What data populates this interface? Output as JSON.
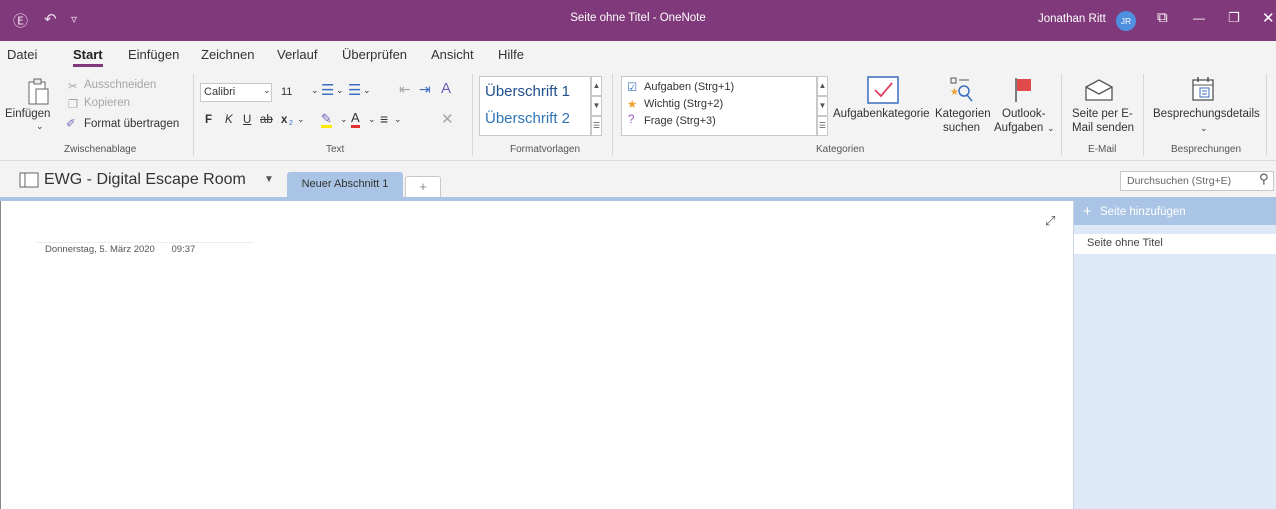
{
  "titlebar": {
    "title": "Seite ohne Titel - OneNote",
    "user": "Jonathan Ritt",
    "avatar": "JR",
    "back_icon": "Ⓔ",
    "undo_icon": "↶",
    "dropdown_icon": "▿",
    "ribbon_display_icon": "⧉",
    "minimize_icon": "—",
    "restore_icon": "❐",
    "close_icon": "✕",
    "color": "#80397b"
  },
  "menu": [
    "Datei",
    "Start",
    "Einfügen",
    "Zeichnen",
    "Verlauf",
    "Überprüfen",
    "Ansicht",
    "Hilfe"
  ],
  "menu_active": "Start",
  "ribbon": {
    "clipboard": {
      "paste": "Einfügen",
      "cut": "Ausschneiden",
      "copy": "Kopieren",
      "format_painter": "Format übertragen",
      "label": "Zwischenablage"
    },
    "text": {
      "font": "Calibri",
      "size": "11",
      "bold": "F",
      "italic": "K",
      "underline": "U",
      "strike": "ab",
      "subscript": "x",
      "label": "Text"
    },
    "styles": {
      "heading1": "Überschrift 1",
      "heading2": "Überschrift 2",
      "label": "Formatvorlagen"
    },
    "tags": {
      "items": [
        "Aufgaben (Strg+1)",
        "Wichtig (Strg+2)",
        "Frage (Strg+3)"
      ],
      "task_category": "Aufgabenkategorie",
      "search_tags_1": "Kategorien",
      "search_tags_2": "suchen",
      "outlook_1": "Outlook-",
      "outlook_2": "Aufgaben",
      "label": "Kategorien"
    },
    "email": {
      "line1": "Seite per E-",
      "line2": "Mail senden",
      "label": "E-Mail"
    },
    "meetings": {
      "details": "Besprechungsdetails",
      "label": "Besprechungen"
    }
  },
  "navbar": {
    "notebook": "EWG - Digital Escape Room",
    "section_tab": "Neuer Abschnitt 1",
    "add_tab": "+",
    "search_placeholder": "Durchsuchen (Strg+E)"
  },
  "page": {
    "date": "Donnerstag, 5. März 2020",
    "time": "09:37"
  },
  "pages_pane": {
    "add_page": "Seite hinzufügen",
    "items": [
      "Seite ohne Titel"
    ]
  }
}
